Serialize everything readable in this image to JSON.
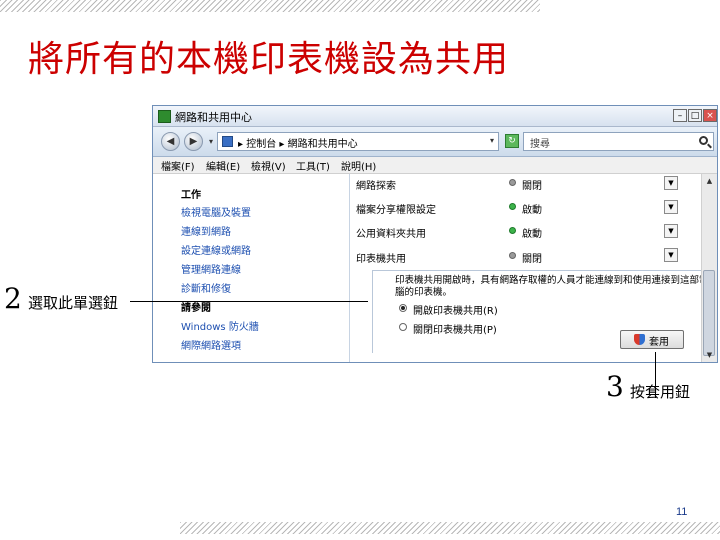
{
  "slide": {
    "title": "將所有的本機印表機設為共用",
    "page_number": "11"
  },
  "window": {
    "title": "網路和共用中心",
    "buttons": {
      "minimize": "–",
      "maximize": "□",
      "close": "×"
    },
    "nav": {
      "back": "◀",
      "forward": "▶",
      "dropdown": "▾"
    },
    "address": {
      "path": "▸ 控制台 ▸ 網路和共用中心",
      "dropdown": "▾"
    },
    "refresh": "↻",
    "search": {
      "placeholder": "搜尋"
    },
    "menu": [
      "檔案(F)",
      "編輯(E)",
      "檢視(V)",
      "工具(T)",
      "說明(H)"
    ]
  },
  "sidebar": {
    "tasks_heading": "工作",
    "tasks": [
      "檢視電腦及裝置",
      "連線到網路",
      "設定連線或網路",
      "管理網路連線",
      "診斷和修復"
    ],
    "see_also_heading": "請參閱",
    "see_also": [
      "Windows 防火牆",
      "網際網路選項"
    ]
  },
  "sharing": {
    "rows": [
      {
        "label": "網路探索",
        "status": "關閉",
        "on": false
      },
      {
        "label": "檔案分享權限設定",
        "status": "啟動",
        "on": true
      },
      {
        "label": "公用資料夾共用",
        "status": "啟動",
        "on": true
      },
      {
        "label": "印表機共用",
        "status": "關閉",
        "on": false
      }
    ],
    "expand_glyph": "▼",
    "printer_detail": {
      "description": "印表機共用開啟時，具有網路存取權的人員才能連線到和使用連接到這部電腦的印表機。",
      "options": [
        "開啟印表機共用(R)",
        "關閉印表機共用(P)"
      ],
      "selected_index": 0,
      "apply_label": "套用"
    }
  },
  "scrollbar": {
    "up": "▲",
    "down": "▼"
  },
  "callouts": [
    {
      "number": "2",
      "text": "選取此單選鈕"
    },
    {
      "number": "3",
      "text": "按套用鈕"
    }
  ]
}
